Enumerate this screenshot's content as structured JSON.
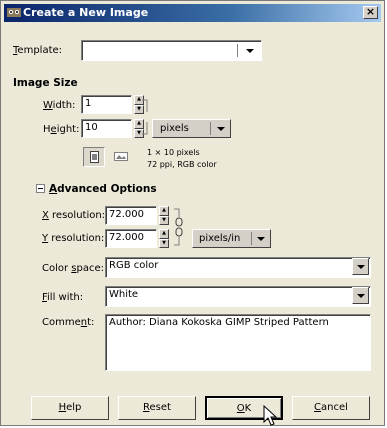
{
  "window": {
    "title": "Create a New Image",
    "close": "×"
  },
  "template": {
    "label": "Template:",
    "value": ""
  },
  "image_size": {
    "heading": "Image Size",
    "width_label": "Width:",
    "width_value": "1",
    "height_label": "Height:",
    "height_value": "10",
    "unit": "pixels",
    "info_line1": "1 × 10 pixels",
    "info_line2": "72 ppi, RGB color"
  },
  "advanced": {
    "heading": "Advanced Options",
    "xres_label": "X resolution:",
    "xres_value": "72.000",
    "yres_label": "Y resolution:",
    "yres_value": "72.000",
    "res_unit": "pixels/in",
    "colorspace_label": "Color space:",
    "colorspace_value": "RGB color",
    "fill_label": "Fill with:",
    "fill_value": "White",
    "comment_label": "Comment:",
    "comment_value": "Author:  Diana Kokoska GIMP Striped Pattern"
  },
  "buttons": {
    "help": "Help",
    "reset": "Reset",
    "ok": "OK",
    "cancel": "Cancel"
  },
  "colors": {
    "titlebar": "#0a246a",
    "dialog_bg": "#ece9d8"
  }
}
